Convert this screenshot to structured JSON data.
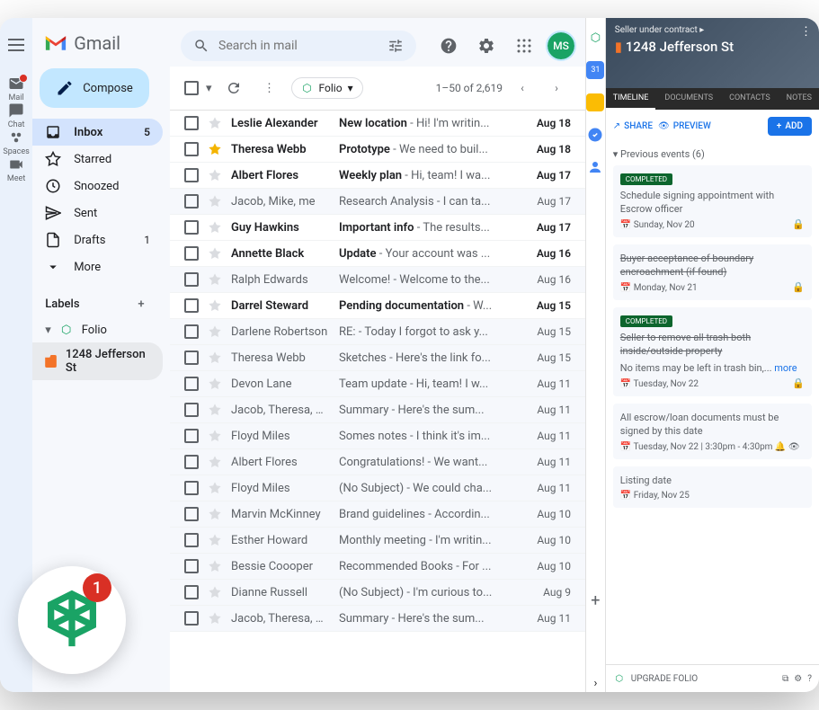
{
  "brand": "Gmail",
  "rail": [
    {
      "name": "mail",
      "label": "Mail",
      "badge": true
    },
    {
      "name": "chat",
      "label": "Chat"
    },
    {
      "name": "spaces",
      "label": "Spaces"
    },
    {
      "name": "meet",
      "label": "Meet"
    }
  ],
  "compose_label": "Compose",
  "nav": [
    {
      "icon": "inbox",
      "label": "Inbox",
      "count": "5",
      "active": true
    },
    {
      "icon": "star",
      "label": "Starred"
    },
    {
      "icon": "clock",
      "label": "Snoozed"
    },
    {
      "icon": "send",
      "label": "Sent"
    },
    {
      "icon": "draft",
      "label": "Drafts",
      "count": "1"
    },
    {
      "icon": "more",
      "label": "More"
    }
  ],
  "labels_header": "Labels",
  "labels": [
    {
      "icon": "folio",
      "label": "Folio"
    },
    {
      "icon": "folder",
      "label": "1248 Jefferson St",
      "selected": true
    }
  ],
  "search": {
    "placeholder": "Search in mail"
  },
  "toolbar": {
    "folio_label": "Folio",
    "pager": "1–50 of 2,619"
  },
  "avatar": "MS",
  "emails": [
    {
      "sender": "Leslie Alexander",
      "subject": "New location",
      "snippet": "Hi! I'm writin...",
      "date": "Aug 18",
      "unread": true
    },
    {
      "sender": "Theresa Webb",
      "subject": "Prototype",
      "snippet": "We need to buil...",
      "date": "Aug 18",
      "unread": true,
      "starred": true
    },
    {
      "sender": "Albert Flores",
      "subject": "Weekly plan",
      "snippet": "Hi, team! I wa...",
      "date": "Aug 17",
      "unread": true
    },
    {
      "sender": "Jacob, Mike, me",
      "subject": "Research Analysis",
      "snippet": "I can ta...",
      "date": "Aug 17"
    },
    {
      "sender": "Guy Hawkins",
      "subject": "Important info",
      "snippet": "The results...",
      "date": "Aug 17",
      "unread": true
    },
    {
      "sender": "Annette Black",
      "subject": "Update",
      "snippet": "Your account was ...",
      "date": "Aug 16",
      "unread": true
    },
    {
      "sender": "Ralph Edwards",
      "subject": "Welcome!",
      "snippet": "Welcome to the...",
      "date": "Aug 16"
    },
    {
      "sender": "Darrel Steward",
      "subject": "Pending documentation",
      "snippet": "W...",
      "date": "Aug 15",
      "unread": true
    },
    {
      "sender": "Darlene Robertson",
      "subject": "RE:",
      "snippet": "Today I forgot to ask y...",
      "date": "Aug 15"
    },
    {
      "sender": "Theresa Webb",
      "subject": "Sketches",
      "snippet": "Here's the link fo...",
      "date": "Aug 15"
    },
    {
      "sender": "Devon Lane",
      "subject": "Team update",
      "snippet": "Hi, team! I w...",
      "date": "Aug 11"
    },
    {
      "sender": "Jacob, Theresa, me",
      "subject": "Summary",
      "snippet": "Here's the sum...",
      "date": "Aug 11"
    },
    {
      "sender": "Floyd Miles",
      "subject": "Somes notes",
      "snippet": "I think it's im...",
      "date": "Aug 11"
    },
    {
      "sender": "Albert Flores",
      "subject": "Congratulations!",
      "snippet": "We want...",
      "date": "Aug 11"
    },
    {
      "sender": "Floyd Miles",
      "subject": "(No Subject)",
      "snippet": "We could cha...",
      "date": "Aug 11"
    },
    {
      "sender": "Marvin McKinney",
      "subject": "Brand guidelines",
      "snippet": "Accordin...",
      "date": "Aug 10"
    },
    {
      "sender": "Esther Howard",
      "subject": "Monthly meeting",
      "snippet": "I'm writin...",
      "date": "Aug 10"
    },
    {
      "sender": "Bessie Coooper",
      "subject": "Recommended Books",
      "snippet": "For ...",
      "date": "Aug 10"
    },
    {
      "sender": "Dianne Russell",
      "subject": "(No Subject)",
      "snippet": "I'm curious to...",
      "date": "Aug 9"
    },
    {
      "sender": "Jacob, Theresa, me",
      "subject": "Summary",
      "snippet": "Here's the sum...",
      "date": "Aug 11"
    }
  ],
  "panel": {
    "status": "Seller under contract",
    "title": "1248 Jefferson St",
    "tabs": [
      "TIMELINE",
      "DOCUMENTS",
      "CONTACTS",
      "NOTES"
    ],
    "share": "SHARE",
    "preview": "PREVIEW",
    "add": "ADD",
    "prev_events": "Previous events (6)",
    "completed_label": "COMPLETED",
    "more_label": "more",
    "events": [
      {
        "completed": true,
        "title": "Schedule signing appointment with Escrow officer",
        "date": "Sunday, Nov 20",
        "lock": true
      },
      {
        "completed": false,
        "title": "Buyer acceptance of boundary encroachment (if found)",
        "strike": true,
        "date": "Monday, Nov 21",
        "lock": true
      },
      {
        "completed": true,
        "title": "Seller to remove all trash both inside/outside property",
        "strike": true,
        "note": "No items may be left in trash bin,...",
        "date": "Tuesday, Nov 22",
        "lock": true
      },
      {
        "completed": false,
        "title": "All escrow/loan documents must be signed by this date",
        "date": "Tuesday, Nov 22 | 3:30pm - 4:30pm",
        "bell": true
      },
      {
        "completed": false,
        "title": "Listing date",
        "date": "Friday, Nov 25"
      }
    ],
    "upgrade": "UPGRADE FOLIO"
  },
  "float_count": "1"
}
